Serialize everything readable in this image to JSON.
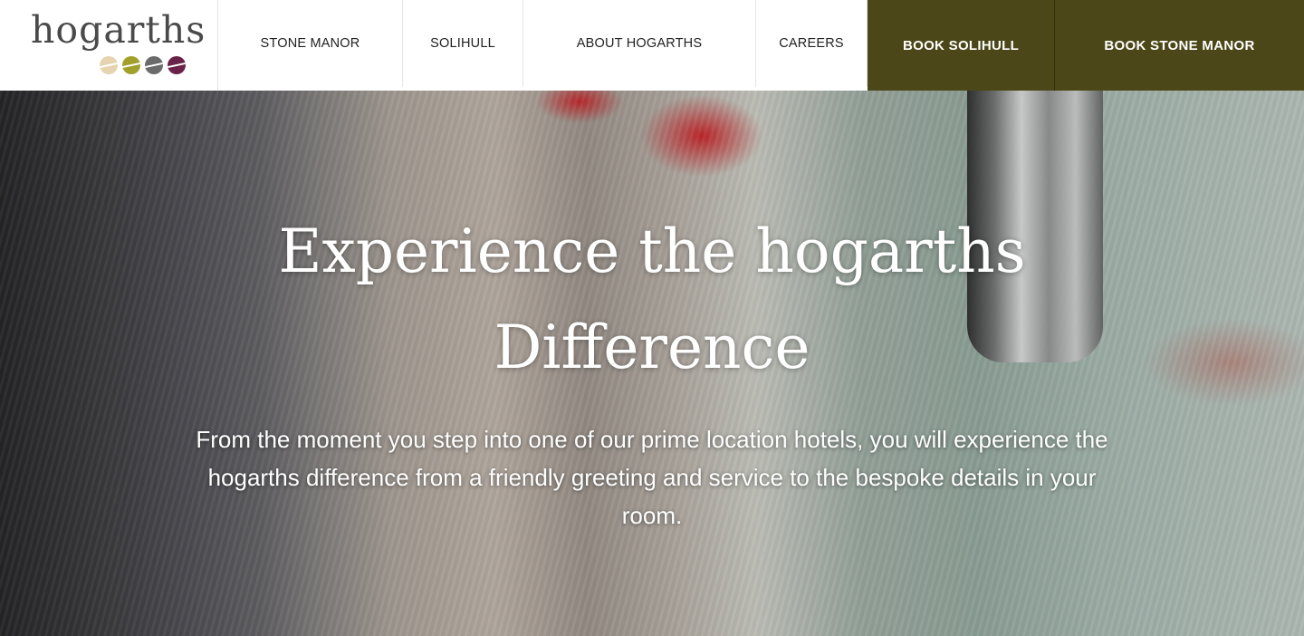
{
  "header": {
    "logo": {
      "text": "hogarths",
      "dot_colors": [
        "#e6d4b0",
        "#a2a02a",
        "#6b6b6b",
        "#6a2248"
      ]
    },
    "nav": [
      "STONE MANOR",
      "SOLIHULL",
      "ABOUT HOGARTHS",
      "CAREERS"
    ],
    "book": [
      "BOOK SOLIHULL",
      "BOOK STONE MANOR"
    ],
    "book_color": "#4b4718"
  },
  "hero": {
    "title_line1": "Experience the hogarths",
    "title_line2": "Difference",
    "body_line1": "From the moment you step into one of our prime location hotels, you will experience the",
    "body_line2": "hogarths difference from a friendly greeting and service to the bespoke details in your",
    "body_line3": "room."
  }
}
